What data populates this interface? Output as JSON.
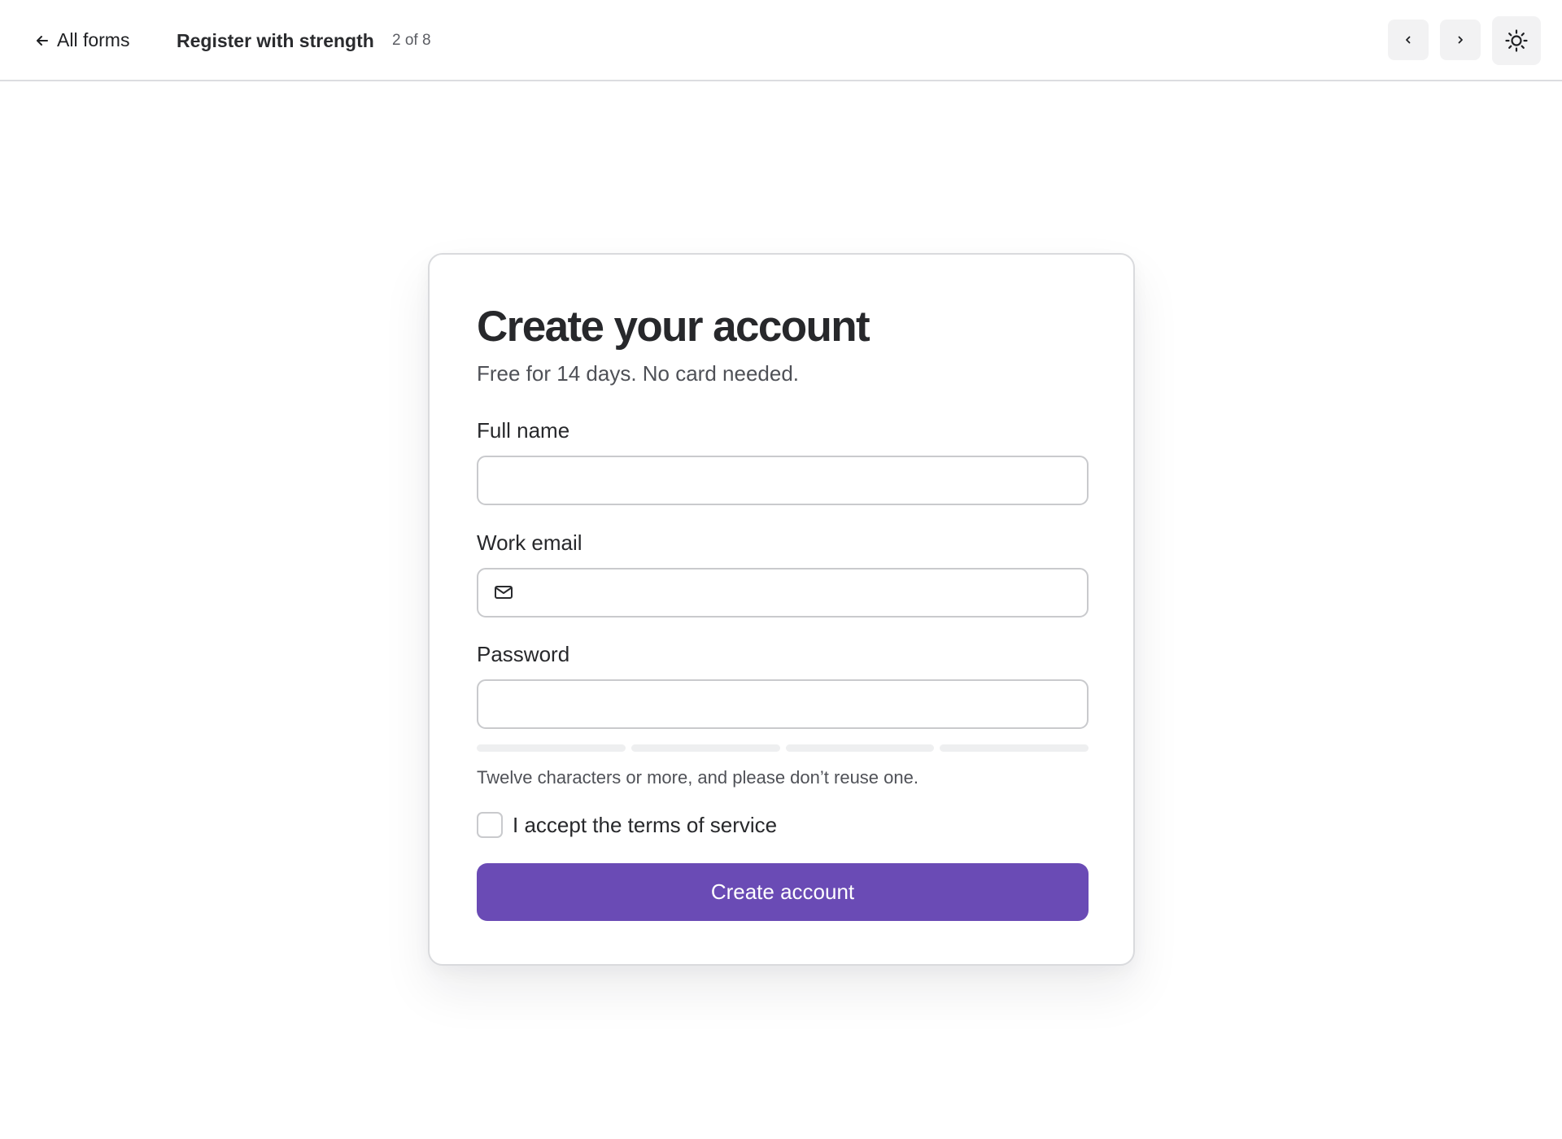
{
  "header": {
    "back_label": "All forms",
    "back_icon": "arrow-left-icon",
    "form_title": "Register with strength",
    "counter": "2 of 8",
    "prev_icon": "chevron-left-icon",
    "next_icon": "chevron-right-icon",
    "theme_icon": "sun-icon"
  },
  "card": {
    "title": "Create your account",
    "subtitle": "Free for 14 days. No card needed.",
    "fields": {
      "full_name": {
        "label": "Full name",
        "value": ""
      },
      "work_email": {
        "label": "Work email",
        "value": "",
        "icon": "mail-icon"
      },
      "password": {
        "label": "Password",
        "value": ""
      }
    },
    "strength": {
      "segments": 4,
      "filled": 0,
      "empty_color": "#eeeff0"
    },
    "hint": "Twelve characters or more, and please don’t reuse one.",
    "terms": {
      "label": "I accept the terms of service",
      "checked": false
    },
    "submit_label": "Create account"
  },
  "colors": {
    "accent": "#6a4bb5",
    "border": "#c9cacd",
    "text": "#27282b",
    "muted": "#4f5157"
  }
}
